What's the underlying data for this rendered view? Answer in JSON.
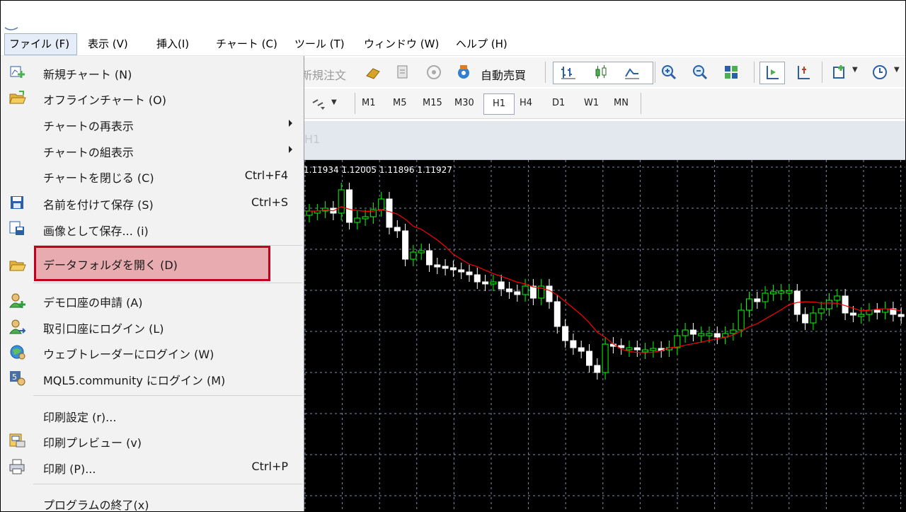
{
  "menubar": {
    "items": [
      {
        "label": "ファイル (F)"
      },
      {
        "label": "表示 (V)"
      },
      {
        "label": "挿入(I)"
      },
      {
        "label": "チャート (C)"
      },
      {
        "label": "ツール (T)"
      },
      {
        "label": "ウィンドウ (W)"
      },
      {
        "label": "ヘルプ (H)"
      }
    ]
  },
  "toolbar": {
    "new_order_label": "新規注文",
    "auto_trade_label": "自動売買"
  },
  "timeframes": [
    "M1",
    "M5",
    "M15",
    "M30",
    "H1",
    "H4",
    "D1",
    "W1",
    "MN"
  ],
  "selected_timeframe": "H1",
  "chart": {
    "window_label": "H1",
    "ohlc_text": "1.11934 1.12005 1.11896 1.11927",
    "background_color": "#000000",
    "bull_color": "#00ff00",
    "bear_color": "#ffffff",
    "ma_color": "#ff0000",
    "grid_color": "#7a8da4"
  },
  "file_menu": {
    "items": [
      {
        "label": "新規チャート (N)",
        "icon": "new-chart-icon"
      },
      {
        "label": "オフラインチャート (O)",
        "icon": "open-folder-icon"
      },
      {
        "label": "チャートの再表示",
        "submenu": true
      },
      {
        "label": "チャートの組表示",
        "submenu": true
      },
      {
        "label": "チャートを閉じる (C)",
        "shortcut": "Ctrl+F4"
      },
      {
        "label": "名前を付けて保存 (S)",
        "shortcut": "Ctrl+S",
        "icon": "save-icon"
      },
      {
        "label": "画像として保存... (i)",
        "icon": "save-image-icon"
      },
      {
        "label": "データフォルダを開く (D)",
        "icon": "folder-icon",
        "highlighted": true
      },
      {
        "label": "デモ口座の申請 (A)",
        "icon": "demo-account-icon"
      },
      {
        "label": "取引口座にログイン (L)",
        "icon": "login-icon"
      },
      {
        "label": "ウェブトレーダーにログイン (W)",
        "icon": "webtrader-icon"
      },
      {
        "label": "MQL5.community にログイン (M)",
        "icon": "mql5-icon"
      },
      {
        "label": "印刷設定 (r)..."
      },
      {
        "label": "印刷プレビュー (v)",
        "icon": "print-preview-icon"
      },
      {
        "label": "印刷 (P)...",
        "shortcut": "Ctrl+P",
        "icon": "printer-icon"
      },
      {
        "label": "プログラムの終了(x)"
      }
    ],
    "highlight_color": "#c0001c"
  }
}
